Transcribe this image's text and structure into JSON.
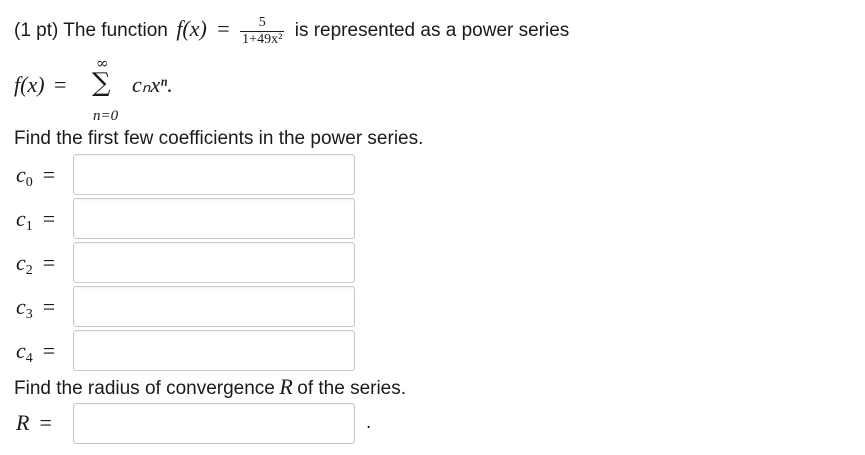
{
  "problem": {
    "prefix": "(1 pt) The function",
    "fx": "f(x)",
    "equals": "=",
    "frac_num": "5",
    "frac_den": "1+49x²",
    "suffix": "is represented as a power series"
  },
  "series": {
    "lhs": "f(x)",
    "equals": "=",
    "sum_upper": "∞",
    "sum_symbol": "∑",
    "sum_lower": "n=0",
    "term": "cₙxⁿ."
  },
  "prompt_coeffs": "Find the first few coefficients in the power series.",
  "coefficients": [
    {
      "label": "c",
      "index": "0",
      "equals": "=",
      "value": ""
    },
    {
      "label": "c",
      "index": "1",
      "equals": "=",
      "value": ""
    },
    {
      "label": "c",
      "index": "2",
      "equals": "=",
      "value": ""
    },
    {
      "label": "c",
      "index": "3",
      "equals": "=",
      "value": ""
    },
    {
      "label": "c",
      "index": "4",
      "equals": "=",
      "value": ""
    }
  ],
  "prompt_radius": {
    "before": "Find the radius of convergence",
    "symbol": "R",
    "after": "of the series."
  },
  "radius": {
    "label": "R",
    "equals": "=",
    "value": "",
    "trailing": "."
  }
}
